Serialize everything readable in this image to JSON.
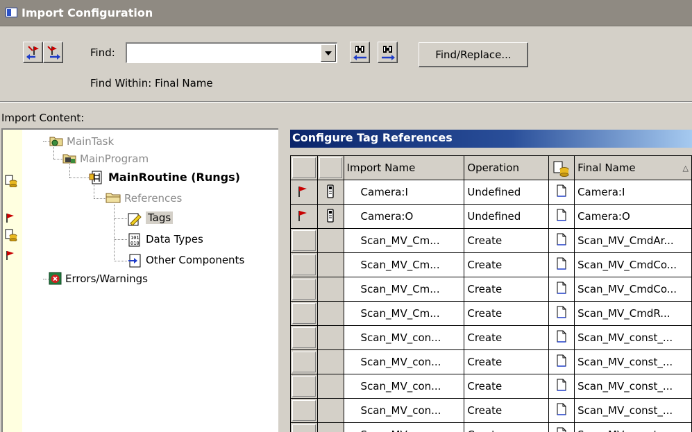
{
  "window": {
    "title": "Import Configuration"
  },
  "toolbar": {
    "find_label": "Find:",
    "find_value": "",
    "find_within": "Find Within: Final Name",
    "find_replace_label": "Find/Replace..."
  },
  "import_content_label": "Import Content:",
  "tree": [
    {
      "label": "MainTask",
      "style": "grey"
    },
    {
      "label": "MainProgram",
      "style": "grey"
    },
    {
      "label": "MainRoutine (Rungs)",
      "style": "bold"
    },
    {
      "label": "References",
      "style": "grey"
    },
    {
      "label": "Tags",
      "style": "selected"
    },
    {
      "label": "Data Types",
      "style": "normal"
    },
    {
      "label": "Other Components",
      "style": "normal"
    },
    {
      "label": "Errors/Warnings",
      "style": "normal"
    }
  ],
  "grid": {
    "title": "Configure Tag References",
    "columns": {
      "import_name": "Import Name",
      "operation": "Operation",
      "final_name": "Final Name"
    },
    "rows": [
      {
        "flag": true,
        "tag": true,
        "import_name": "Camera:I",
        "operation": "Undefined",
        "final_name": "Camera:I"
      },
      {
        "flag": true,
        "tag": true,
        "import_name": "Camera:O",
        "operation": "Undefined",
        "final_name": "Camera:O"
      },
      {
        "flag": false,
        "tag": false,
        "import_name": "Scan_MV_Cm...",
        "operation": "Create",
        "final_name": "Scan_MV_CmdAr..."
      },
      {
        "flag": false,
        "tag": false,
        "import_name": "Scan_MV_Cm...",
        "operation": "Create",
        "final_name": "Scan_MV_CmdCo..."
      },
      {
        "flag": false,
        "tag": false,
        "import_name": "Scan_MV_Cm...",
        "operation": "Create",
        "final_name": "Scan_MV_CmdCo..."
      },
      {
        "flag": false,
        "tag": false,
        "import_name": "Scan_MV_Cm...",
        "operation": "Create",
        "final_name": "Scan_MV_CmdR..."
      },
      {
        "flag": false,
        "tag": false,
        "import_name": "Scan_MV_con...",
        "operation": "Create",
        "final_name": "Scan_MV_const_..."
      },
      {
        "flag": false,
        "tag": false,
        "import_name": "Scan_MV_con...",
        "operation": "Create",
        "final_name": "Scan_MV_const_..."
      },
      {
        "flag": false,
        "tag": false,
        "import_name": "Scan_MV_con...",
        "operation": "Create",
        "final_name": "Scan_MV_const_..."
      },
      {
        "flag": false,
        "tag": false,
        "import_name": "Scan_MV_con...",
        "operation": "Create",
        "final_name": "Scan_MV_const_..."
      },
      {
        "flag": false,
        "tag": false,
        "import_name": "Scan_MV_con...",
        "operation": "Create",
        "final_name": "Scan_MV_const_..."
      }
    ]
  },
  "colors": {
    "title_bar": "#8f8a82",
    "grid_header": "#0a246a",
    "flag": "#c80000",
    "face": "#d4d0c8"
  }
}
